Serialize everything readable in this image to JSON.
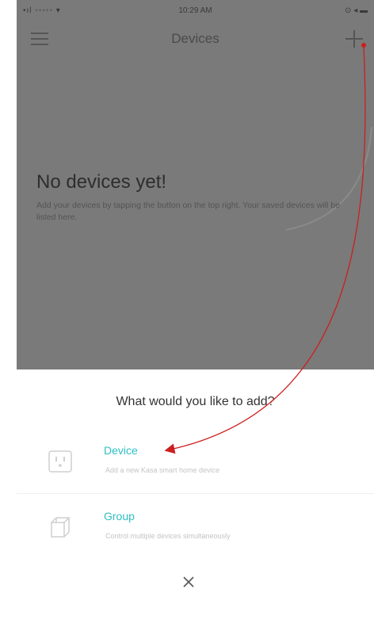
{
  "status_bar": {
    "carrier": "•ıl ◦◦◦◦◦ ▾",
    "time": "10:29 AM",
    "battery": "⊙ ◂ ▬"
  },
  "nav": {
    "title": "Devices"
  },
  "empty_state": {
    "title": "No devices yet!",
    "description": "Add your devices by tapping the button on the top right. Your saved devices will be listed here."
  },
  "sheet": {
    "title": "What would you like to add?",
    "options": [
      {
        "label": "Device",
        "sublabel": "Add a new Kasa smart home device",
        "icon": "smart-plug-icon"
      },
      {
        "label": "Group",
        "sublabel": "Control multiple devices simultaneously",
        "icon": "stacked-cubes-icon"
      }
    ],
    "close_icon": "close-icon"
  },
  "colors": {
    "accent": "#2fbfc4",
    "overlay": "#7a7a7a",
    "annotation_arrow": "#cc1f1f"
  }
}
